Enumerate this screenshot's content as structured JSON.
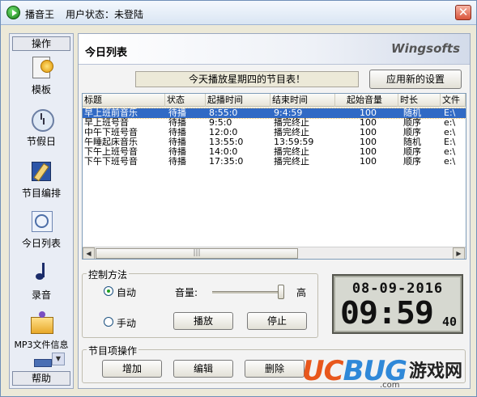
{
  "window": {
    "app_name": "播音王",
    "status_label": "用户状态：未登陆",
    "close_glyph": "✕"
  },
  "nav": {
    "header": "操作",
    "footer": "帮助",
    "items": [
      {
        "label": "模板",
        "icon": "template-icon"
      },
      {
        "label": "节假日",
        "icon": "clock-icon"
      },
      {
        "label": "节目编排",
        "icon": "edit-icon"
      },
      {
        "label": "今日列表",
        "icon": "today-list-icon"
      },
      {
        "label": "录音",
        "icon": "music-note-icon"
      },
      {
        "label": "MP3文件信息",
        "icon": "mp3-folder-icon"
      }
    ]
  },
  "main": {
    "title": "今日列表",
    "brand": "Wingsofts",
    "notice": "今天播放星期四的节目表！",
    "apply_button": "应用新的设置"
  },
  "table": {
    "columns": [
      "标题",
      "状态",
      "起播时间",
      "结束时间",
      "起始音量",
      "时长",
      "文件"
    ],
    "rows": [
      {
        "title": "早上班前音乐",
        "status": "待播",
        "start": "8:55:0",
        "end": "9:4:59",
        "volume": "100",
        "mode": "随机",
        "file": "E:\\",
        "selected": true
      },
      {
        "title": "早上班号音",
        "status": "待播",
        "start": "9:5:0",
        "end": "播完终止",
        "volume": "100",
        "mode": "顺序",
        "file": "e:\\"
      },
      {
        "title": "中午下班号音",
        "status": "待播",
        "start": "12:0:0",
        "end": "播完终止",
        "volume": "100",
        "mode": "顺序",
        "file": "e:\\"
      },
      {
        "title": "午睡起床音乐",
        "status": "待播",
        "start": "13:55:0",
        "end": "13:59:59",
        "volume": "100",
        "mode": "随机",
        "file": "E:\\"
      },
      {
        "title": "下午上班号音",
        "status": "待播",
        "start": "14:0:0",
        "end": "播完终止",
        "volume": "100",
        "mode": "顺序",
        "file": "e:\\"
      },
      {
        "title": "下午下班号音",
        "status": "待播",
        "start": "17:35:0",
        "end": "播完终止",
        "volume": "100",
        "mode": "顺序",
        "file": "e:\\"
      }
    ],
    "scroll_left": "◀",
    "scroll_right": "▶",
    "thumb_grip": "|||"
  },
  "control": {
    "group_title": "控制方法",
    "auto_label": "自动",
    "manual_label": "手动",
    "mode_selected": "自动",
    "volume_label": "音量:",
    "volume_high": "高",
    "volume_level": 1.0,
    "play_button": "播放",
    "stop_button": "停止"
  },
  "clock": {
    "date": "08-09-2016",
    "time": "09:59",
    "seconds": "40"
  },
  "item_ops": {
    "group_title": "节目项操作",
    "add_button": "增加",
    "edit_button": "编辑",
    "delete_button": "删除"
  },
  "watermark": {
    "uc": "UC",
    "bug": "BUG",
    "cn": "游戏网",
    "url": ".com"
  },
  "colors": {
    "selection": "#316ac5",
    "watermark_orange": "#e8571c",
    "watermark_blue": "#2f88d8"
  }
}
